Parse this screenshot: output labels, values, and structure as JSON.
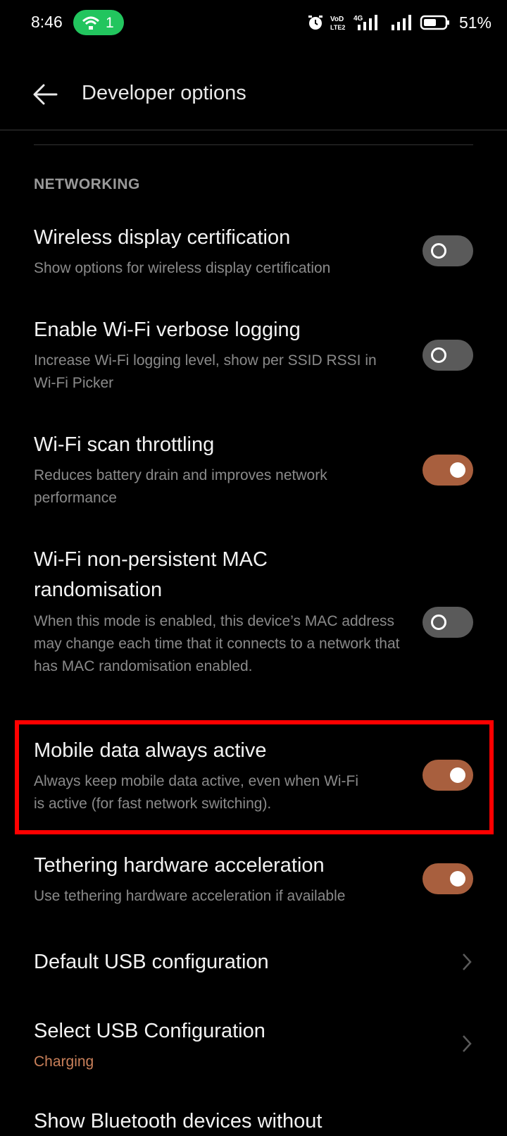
{
  "status_bar": {
    "time": "8:46",
    "hotspot_count": "1",
    "volte_label": "VoD LTE2",
    "network_label": "4G",
    "battery_percent": "51%",
    "accent_hotspot": "#22c55e"
  },
  "toolbar": {
    "title": "Developer options",
    "back_icon": "arrow-left-icon"
  },
  "section": {
    "header": "NETWORKING"
  },
  "settings": [
    {
      "title": "Wireless display certification",
      "subtitle": "Show options for wireless display certification",
      "toggle": "off"
    },
    {
      "title": "Enable Wi-Fi verbose logging",
      "subtitle": "Increase Wi-Fi logging level, show per SSID RSSI in Wi-Fi Picker",
      "toggle": "off"
    },
    {
      "title": "Wi-Fi scan throttling",
      "subtitle": "Reduces battery drain and improves network performance",
      "toggle": "on"
    },
    {
      "title": "Wi-Fi non-persistent MAC randomisation",
      "subtitle": "When this mode is enabled, this device’s MAC address may change each time that it connects to a network that has MAC randomisation enabled.",
      "toggle": "off"
    },
    {
      "title": "Mobile data always active",
      "subtitle": "Always keep mobile data active, even when Wi-Fi is active (for fast network switching).",
      "toggle": "on",
      "highlighted": true
    },
    {
      "title": "Tethering hardware acceleration",
      "subtitle": "Use tethering hardware acceleration if available",
      "toggle": "on"
    },
    {
      "title": "Default USB configuration",
      "subtitle": "",
      "chevron": true
    },
    {
      "title": "Select USB Configuration",
      "subtitle": "Charging",
      "chevron": true
    },
    {
      "title": "Show Bluetooth devices without",
      "subtitle": ""
    }
  ],
  "colors": {
    "toggle_on": "#a85f3e",
    "toggle_off": "#5a5a5a",
    "highlight": "#ff0000",
    "value_accent": "#c9805a"
  }
}
